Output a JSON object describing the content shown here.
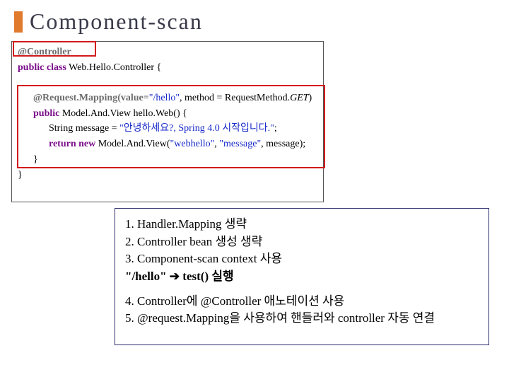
{
  "title": "Component-scan",
  "code": {
    "l1_ann": "@Controller",
    "l2_kw": "public class",
    "l2_rest": " Web.Hello.Controller {",
    "l3_ann": "@Request.Mapping(value=",
    "l3_str1": "\"/hello\"",
    "l3_mid": ", method = RequestMethod.",
    "l3_get": "GET",
    "l3_end": ")",
    "l4_kw": "public",
    "l4_rest": " Model.And.View hello.Web() {",
    "l5a": "String message = ",
    "l5_str": "\"안녕하세요?, Spring 4.0 시작입니다.\"",
    "l5b": ";",
    "l6_kw": "return new",
    "l6_rest": " Model.And.View(",
    "l6_s1": "\"webhello\"",
    "l6_c1": ", ",
    "l6_s2": "\"message\"",
    "l6_c2": ", message);",
    "l7": "}",
    "l8": "}"
  },
  "notes": {
    "n1": "1. Handler.Mapping 생략",
    "n2": "2. Controller bean 생성  생략",
    "n3": "3. Component-scan context 사용",
    "n3b_a": "   \"/hello\"  ",
    "n3b_arrow": "➔",
    "n3b_b": "  test()  실행",
    "n4": "4. Controller에 @Controller 애노테이션 사용",
    "n5": "5. @request.Mapping을 사용하여 핸들러와 controller  자동 연결"
  }
}
